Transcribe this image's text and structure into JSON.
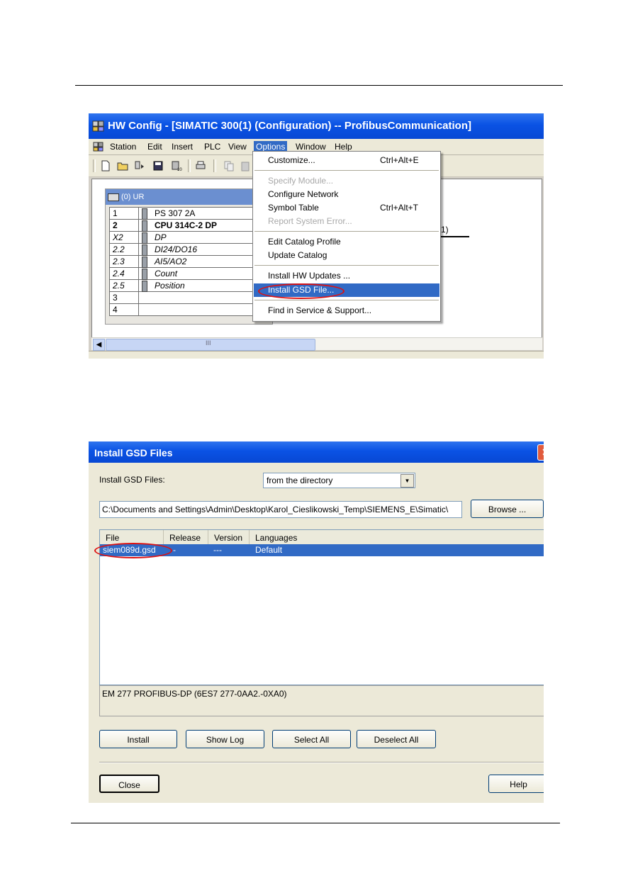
{
  "hw_config": {
    "title": "HW Config - [SIMATIC 300(1) (Configuration) -- ProfibusCommunication]",
    "menu": [
      "Station",
      "Edit",
      "Insert",
      "PLC",
      "View",
      "Options",
      "Window",
      "Help"
    ],
    "active_menu": "Options",
    "rack_label": "(0) UR",
    "rack_rows": [
      {
        "slot": "1",
        "module": "PS 307 2A"
      },
      {
        "slot": "2",
        "module": "CPU 314C-2 DP"
      },
      {
        "slot": "X2",
        "module": "DP"
      },
      {
        "slot": "2.2",
        "module": "DI24/DO16"
      },
      {
        "slot": "2.3",
        "module": "AI5/AO2"
      },
      {
        "slot": "2.4",
        "module": "Count"
      },
      {
        "slot": "2.5",
        "module": "Position"
      },
      {
        "slot": "3",
        "module": ""
      },
      {
        "slot": "4",
        "module": ""
      }
    ],
    "network_label": "1)",
    "scroll_grip": "III",
    "options_menu": [
      {
        "label": "Customize...",
        "shortcut": "Ctrl+Alt+E"
      },
      {
        "label": "Specify Module...",
        "shortcut": ""
      },
      {
        "label": "Configure Network",
        "shortcut": ""
      },
      {
        "label": "Symbol Table",
        "shortcut": "Ctrl+Alt+T"
      },
      {
        "label": "Report System Error...",
        "shortcut": ""
      },
      {
        "label": "Edit Catalog Profile",
        "shortcut": ""
      },
      {
        "label": "Update Catalog",
        "shortcut": ""
      },
      {
        "label": "Install HW Updates ...",
        "shortcut": ""
      },
      {
        "label": "Install GSD File...",
        "shortcut": ""
      },
      {
        "label": "Find in Service & Support...",
        "shortcut": ""
      }
    ]
  },
  "gsd_dialog": {
    "title": "Install GSD Files",
    "source_label": "Install GSD Files:",
    "source_value": "from the directory",
    "path": "C:\\Documents and Settings\\Admin\\Desktop\\Karol_Cieslikowski_Temp\\SIEMENS_E\\Simatic\\",
    "browse_label": "Browse ...",
    "columns": [
      "File",
      "Release",
      "Version",
      "Languages"
    ],
    "rows": [
      {
        "file": "siem089d.gsd",
        "release": "-",
        "version": "---",
        "languages": "Default"
      }
    ],
    "description": "EM 277 PROFIBUS-DP (6ES7 277-0AA2.-0XA0)",
    "buttons": {
      "install": "Install",
      "show_log": "Show Log",
      "select_all": "Select All",
      "deselect_all": "Deselect All",
      "close": "Close",
      "help": "Help"
    }
  }
}
